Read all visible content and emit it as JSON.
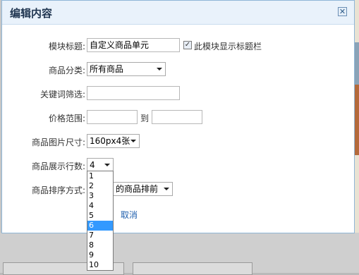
{
  "dialog": {
    "title": "编辑内容",
    "close_glyph": "✕"
  },
  "form": {
    "module_title_label": "模块标题:",
    "module_title_value": "自定义商品单元",
    "show_title_checkbox_label": "此模块显示标题栏",
    "show_title_checked": true,
    "category_label": "商品分类:",
    "category_value": "所有商品",
    "keyword_label": "关键词筛选:",
    "keyword_value": "",
    "price_label": "价格范围:",
    "price_to": "到",
    "price_min": "",
    "price_max": "",
    "image_size_label": "商品图片尺寸:",
    "image_size_value": "160px4张",
    "rows_label": "商品展示行数:",
    "rows_value": "4",
    "sort_label": "商品排序方式:",
    "sort_value_visible": "的商品排前",
    "cancel_label": "取消"
  },
  "rows_dropdown": {
    "options": [
      "1",
      "2",
      "3",
      "4",
      "5",
      "6",
      "7",
      "8",
      "9",
      "10"
    ],
    "highlighted": "6"
  },
  "colors": {
    "titlebar": "#e9f2fb",
    "highlight": "#3399ff",
    "link": "#1f5fae"
  }
}
